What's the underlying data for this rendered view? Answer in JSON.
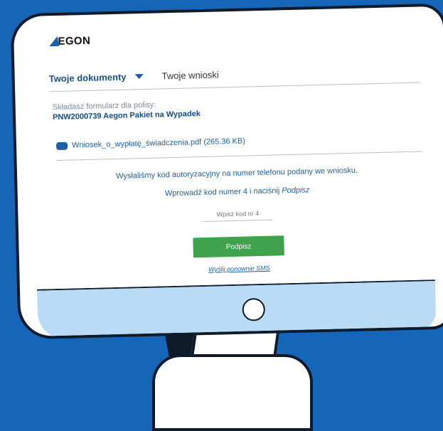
{
  "brand": {
    "logo_text": "EGON",
    "logo_icon": "aegon-logo-icon"
  },
  "tabs": [
    {
      "label": "Twoje dokumenty",
      "active": true
    },
    {
      "label": "Twoje wnioski",
      "active": false
    }
  ],
  "policy": {
    "label": "Składasz formularz dla polisy:",
    "name": "PNW2000739 Aegon Pakiet na Wypadek"
  },
  "attachment": {
    "icon": "paperclip-icon",
    "label": "Wniosek_o_wypłatę_świadczenia.pdf (265.36 KB)"
  },
  "sms": {
    "message": "Wysłaliśmy kod autoryzacyjny na numer telefonu podany we wniosku.",
    "instruction_prefix": "Wprowadź kod numer 4 i naciśnij",
    "instruction_action": "Podpisz",
    "input_placeholder": "Wpisz kod nr 4",
    "sign_label": "Podpisz",
    "resend_label": "Wyślij ponownie SMS"
  },
  "colors": {
    "background": "#1565b8",
    "accent": "#1d5fa8",
    "button": "#3fa34d",
    "chin": "#b9dbf6"
  }
}
